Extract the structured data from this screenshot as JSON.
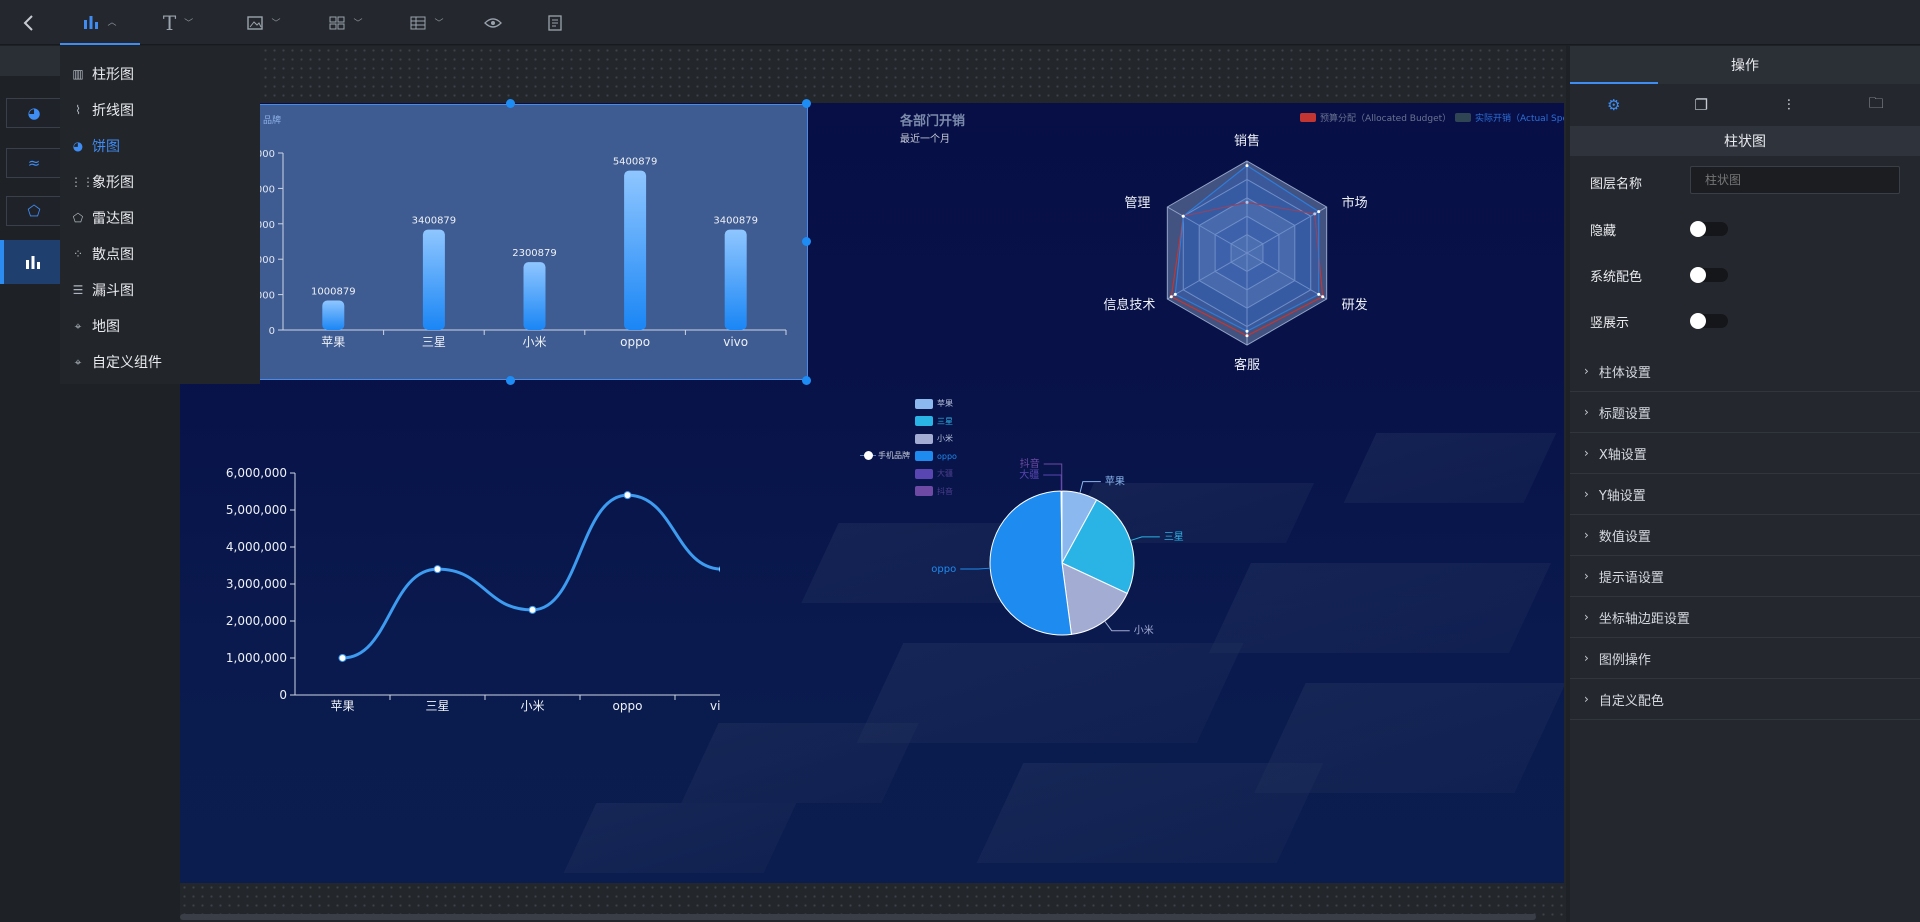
{
  "menu": {
    "items": [
      {
        "label": "柱形图",
        "icon": "bar-chart-icon"
      },
      {
        "label": "折线图",
        "icon": "line-chart-icon"
      },
      {
        "label": "饼图",
        "icon": "pie-chart-icon"
      },
      {
        "label": "象形图",
        "icon": "pictorial-chart-icon"
      },
      {
        "label": "雷达图",
        "icon": "radar-chart-icon"
      },
      {
        "label": "散点图",
        "icon": "scatter-chart-icon"
      },
      {
        "label": "漏斗图",
        "icon": "funnel-chart-icon"
      },
      {
        "label": "地图",
        "icon": "map-icon"
      },
      {
        "label": "自定义组件",
        "icon": "custom-component-icon"
      }
    ],
    "active_index": 2
  },
  "bar_widget": {
    "title": "品牌",
    "ticks": [
      "000",
      "000",
      "000",
      "000",
      "000",
      "0"
    ]
  },
  "radar_widget": {
    "title": "各部门开销",
    "subtitle": "最近一个月",
    "legend": [
      "预算分配（Allocated Budget）",
      "实际开销（Actual Spend"
    ]
  },
  "pie_widget": {
    "legend": [
      "苹果",
      "三星",
      "小米",
      "oppo",
      "大疆",
      "抖音"
    ],
    "series_label": "手机品牌"
  },
  "right_panel": {
    "tab": "操作",
    "section_title": "柱状图",
    "layer_name_label": "图层名称",
    "layer_name_placeholder": "柱状图",
    "hide_label": "隐藏",
    "system_color_label": "系统配色",
    "vertical_label": "竖展示",
    "collapsibles": [
      "柱体设置",
      "标题设置",
      "X轴设置",
      "Y轴设置",
      "数值设置",
      "提示语设置",
      "坐标轴边距设置",
      "图例操作",
      "自定义配色"
    ]
  },
  "colors": {
    "accent": "#3f8cf2",
    "panel": "#24272d",
    "screen": "#081349"
  },
  "chart_data": [
    {
      "type": "bar",
      "title": "品牌",
      "categories": [
        "苹果",
        "三星",
        "小米",
        "oppo",
        "vivo"
      ],
      "values": [
        1000879,
        3400879,
        2300879,
        5400879,
        3400879
      ],
      "ylim": [
        0,
        6000000
      ]
    },
    {
      "type": "line",
      "categories": [
        "苹果",
        "三星",
        "小米",
        "oppo",
        "vivo"
      ],
      "values": [
        1000879,
        3400879,
        2300879,
        5400879,
        3400879
      ],
      "yticks": [
        "0",
        "1,000,000",
        "2,000,000",
        "3,000,000",
        "4,000,000",
        "5,000,000",
        "6,000,000"
      ],
      "ylim": [
        0,
        6000000
      ]
    },
    {
      "type": "radar",
      "title": "各部门开销",
      "subtitle": "最近一个月",
      "indicators": [
        "销售",
        "市场",
        "研发",
        "客服",
        "信息技术",
        "管理"
      ],
      "series": [
        {
          "name": "预算分配（Allocated Budget）",
          "values": [
            0.55,
            0.85,
            0.95,
            0.9,
            0.95,
            0.8
          ]
        },
        {
          "name": "实际开销（Actual Spend",
          "values": [
            0.95,
            0.9,
            0.9,
            0.85,
            0.9,
            0.8
          ]
        }
      ]
    },
    {
      "type": "pie",
      "series_name": "手机品牌",
      "labels": [
        "苹果",
        "三星",
        "小米",
        "oppo",
        "大疆",
        "抖音"
      ],
      "values": [
        8,
        24,
        16,
        52,
        0.1,
        0.1
      ]
    }
  ]
}
